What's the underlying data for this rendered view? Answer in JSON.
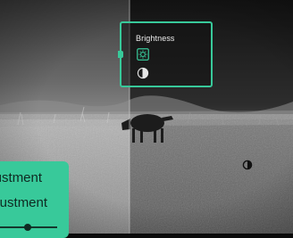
{
  "panel": {
    "title": "Brightness",
    "items": [
      {
        "icon": "brightness-icon",
        "selected": true
      },
      {
        "icon": "contrast-icon",
        "selected": false
      }
    ]
  },
  "adjust_card": {
    "line1": "Adjustment",
    "line2": "Adjustment",
    "slider_value": 0.55
  },
  "overlay": {
    "reticle_icon": "reticle-icon"
  },
  "colors": {
    "accent": "#38c99a",
    "text_light": "#ececec",
    "text_dark": "#0f2a22"
  }
}
